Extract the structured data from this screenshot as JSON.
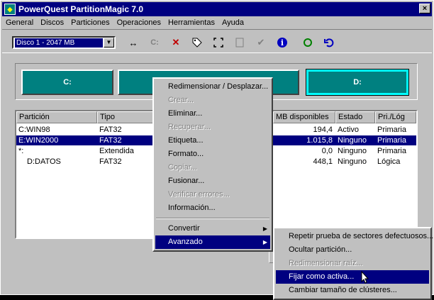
{
  "title": "PowerQuest PartitionMagic 7.0",
  "menu": [
    "General",
    "Discos",
    "Particiones",
    "Operaciones",
    "Herramientas",
    "Ayuda"
  ],
  "disk_selector": "Disco 1 - 2047  MB",
  "toolbar_labels": {
    "c_drive": "C:"
  },
  "partitions_map": [
    {
      "label": "C:"
    },
    {
      "label": ""
    },
    {
      "label": "D:"
    }
  ],
  "columns": [
    "Partición",
    "Tipo",
    "",
    "MB disponibles",
    "Estado",
    "Pri./Lóg"
  ],
  "rows": [
    {
      "name": "C:WIN98",
      "type": "FAT32",
      "free": "194,4",
      "state": "Activo",
      "pri": "Primaria",
      "selected": false
    },
    {
      "name": "E:WIN2000",
      "type": "FAT32",
      "free": "1.015,8",
      "state": "Ninguno",
      "pri": "Primaria",
      "selected": true
    },
    {
      "name": "*:",
      "type": "Extendida",
      "free": "0,0",
      "state": "Ninguno",
      "pri": "Primaria",
      "selected": false
    },
    {
      "name": "D:DATOS",
      "type": "FAT32",
      "free": "448,1",
      "state": "Ninguno",
      "pri": "Lógica",
      "selected": false
    }
  ],
  "context_menu": {
    "items": [
      {
        "label": "Redimensionar / Desplazar...",
        "disabled": false
      },
      {
        "label": "Crear...",
        "disabled": true
      },
      {
        "label": "Eliminar...",
        "disabled": false
      },
      {
        "label": "Recuperar...",
        "disabled": true
      },
      {
        "label": "Etiqueta...",
        "disabled": false
      },
      {
        "label": "Formato...",
        "disabled": false
      },
      {
        "label": "Copiar...",
        "disabled": true
      },
      {
        "label": "Fusionar...",
        "disabled": false
      },
      {
        "label": "Verificar errores...",
        "disabled": true
      },
      {
        "label": "Información...",
        "disabled": false
      }
    ],
    "convert": "Convertir",
    "advanced": "Avanzado"
  },
  "submenu": [
    {
      "label": "Repetir prueba de sectores defectuosos...",
      "disabled": false
    },
    {
      "label": "Ocultar partición...",
      "disabled": false
    },
    {
      "label": "Redimensionar raíz...",
      "disabled": true
    },
    {
      "label": "Fijar como activa...",
      "disabled": false,
      "highlighted": true
    },
    {
      "label": "Cambiar tamaño de clústeres...",
      "disabled": false
    }
  ],
  "colors": {
    "title_bg": "#000080",
    "partition": "#008080",
    "selected_partition_border": "#00ffff"
  }
}
